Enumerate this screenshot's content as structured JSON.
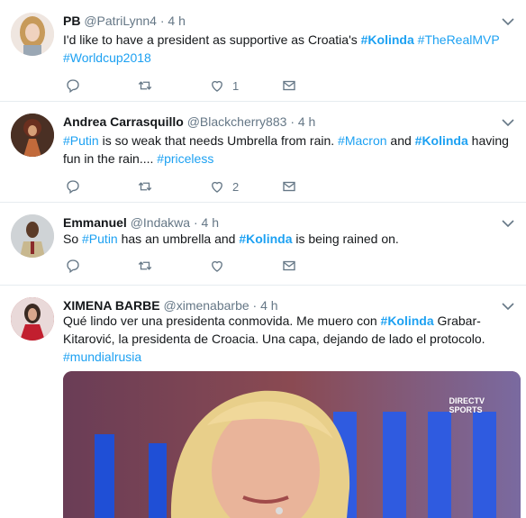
{
  "tweets": [
    {
      "name": "PB",
      "handle": "@PatriLynn4",
      "dot": "·",
      "time": "4 h",
      "text": [
        "I'd like to have a president as supportive as Croatia's ",
        "#Kolinda",
        " ",
        "#TheRealMVP",
        " ",
        "#Worldcup2018"
      ],
      "likes": "1"
    },
    {
      "name": "Andrea Carrasquillo",
      "handle": "@Blackcherry883",
      "dot": "·",
      "time": "4 h",
      "text": [
        "#Putin",
        " is so weak that needs Umbrella from rain.  ",
        "#Macron",
        " and ",
        "#Kolinda",
        " having fun in the rain....  ",
        "#priceless"
      ],
      "likes": "2"
    },
    {
      "name": "Emmanuel",
      "handle": "@Indakwa",
      "dot": "·",
      "time": "4 h",
      "text": [
        "So ",
        "#Putin",
        " has an umbrella and ",
        "#Kolinda",
        " is being rained on."
      ],
      "likes": ""
    },
    {
      "name": "XIMENA BARBE",
      "handle": "@ximenabarbe",
      "dot": "·",
      "time": "4 h",
      "text": [
        "Qué lindo ver una presidenta conmovida. Me muero con ",
        "#Kolinda",
        " Grabar-Kitarović, la presidenta de Croacia. Una capa, dejando de lado el protocolo. ",
        "#mundialrusia"
      ],
      "media_logo": [
        "DIRECTV",
        "SPORTS"
      ]
    }
  ],
  "colors": {
    "link": "#1da1f2",
    "muted": "#657786",
    "divider": "#e6ecf0"
  }
}
